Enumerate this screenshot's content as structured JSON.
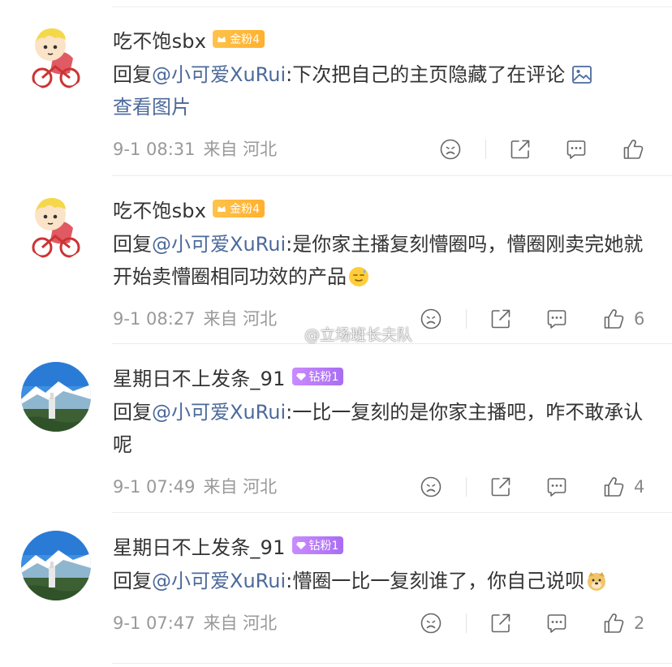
{
  "comments": [
    {
      "username": "吃不饱sbx",
      "badge": {
        "label": "金粉4",
        "color": "#ffb02e"
      },
      "reply_prefix": "回复",
      "mention": "@小可爱XuRui",
      "text": ":下次把自己的主页隐藏了在评论",
      "image_link": "查看图片",
      "time": "9-1 08:31",
      "location": "来自 河北",
      "like_count": ""
    },
    {
      "username": "吃不饱sbx",
      "badge": {
        "label": "金粉4",
        "color": "#ffb02e"
      },
      "reply_prefix": "回复",
      "mention": "@小可爱XuRui",
      "text": ":是你家主播复刻懵圈吗，懵圈刚卖完她就开始卖懵圈相同功效的产品",
      "time": "9-1 08:27",
      "location": "来自 河北",
      "like_count": "6"
    },
    {
      "username": "星期日不上发条_91",
      "badge": {
        "label": "钻粉1",
        "color": "#a86df2"
      },
      "reply_prefix": "回复",
      "mention": "@小可爱XuRui",
      "text": ":一比一复刻的是你家主播吧，咋不敢承认呢",
      "time": "9-1 07:49",
      "location": "来自 河北",
      "like_count": "4"
    },
    {
      "username": "星期日不上发条_91",
      "badge": {
        "label": "钻粉1",
        "color": "#a86df2"
      },
      "reply_prefix": "回复",
      "mention": "@小可爱XuRui",
      "text": ":懵圈一比一复刻谁了，你自己说呗",
      "time": "9-1 07:47",
      "location": "来自 河北",
      "like_count": "2"
    }
  ],
  "watermark": "@立场班长夫队",
  "icons": {
    "dislike": "sad-face-icon",
    "share": "share-icon",
    "comment": "comment-icon",
    "like": "thumb-up-icon",
    "image": "image-icon"
  }
}
